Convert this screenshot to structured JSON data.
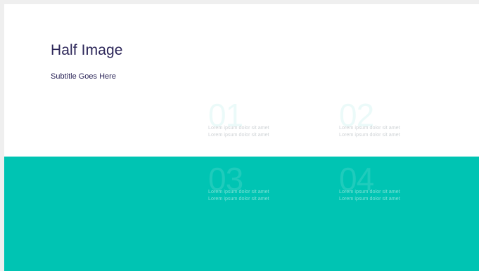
{
  "slide": {
    "title": "Half Image",
    "subtitle": "Subtitle Goes Here",
    "colors": {
      "accent": "#00c4b3",
      "title": "#2b2558",
      "background": "#ffffff"
    }
  },
  "items": [
    {
      "number": "01",
      "line1": "Lorem ipsum dolor sit amet",
      "line2": "Lorem ipsum dolor sit amet"
    },
    {
      "number": "02",
      "line1": "Lorem ipsum dolor sit amet",
      "line2": "Lorem ipsum dolor sit amet"
    },
    {
      "number": "03",
      "line1": "Lorem ipsum dolor sit amet",
      "line2": "Lorem ipsum dolor sit amet"
    },
    {
      "number": "04",
      "line1": "Lorem ipsum dolor sit amet",
      "line2": "Lorem ipsum dolor sit amet"
    }
  ]
}
